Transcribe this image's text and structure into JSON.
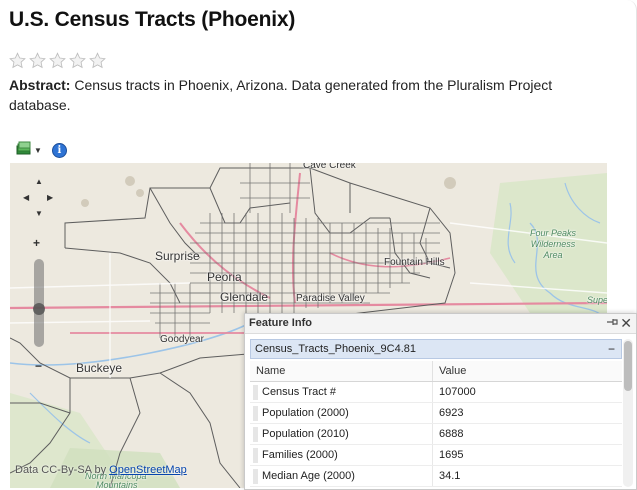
{
  "page": {
    "title": "U.S. Census Tracts (Phoenix)",
    "rating": {
      "max": 5,
      "value": 0
    },
    "abstract_label": "Abstract:",
    "abstract_text": "Census tracts in Phoenix, Arizona. Data generated from the Pluralism Project database."
  },
  "toolbar": {
    "layers_icon": "layers-icon",
    "dropdown_icon": "chevron-down-icon",
    "info_icon": "info-icon",
    "info_glyph": "i"
  },
  "map": {
    "labels": {
      "cave_creek": "Cave Creek",
      "surprise": "Surprise",
      "peoria": "Peoria",
      "glendale": "Glendale",
      "paradise_valley": "Paradise Valley",
      "fountain_hills": "Fountain Hills",
      "goodyear": "Goodyear",
      "buckeye": "Buckeye",
      "four_peaks_1": "Four Peaks",
      "four_peaks_2": "Wilderness",
      "four_peaks_3": "Area",
      "supe": "Supe",
      "north_maricopa": "North Maricopa",
      "mountains": "Mountains"
    },
    "attribution_prefix": "Data CC-By-SA by ",
    "attribution_link": "OpenStreetMap",
    "controls": {
      "zoom_in": "+",
      "zoom_out": "−"
    },
    "colors": {
      "land": "#ede9df",
      "tract_line": "#5e5e5e",
      "highway": "#e58aa0",
      "arterial": "#ffffff",
      "water": "#b9d4ee",
      "park": "#c8dfb5"
    }
  },
  "feature_info": {
    "title": "Feature Info",
    "group_label": "Census_Tracts_Phoenix_9C4.81",
    "collapse_glyph": "−",
    "close_glyph": "✕",
    "pin_glyph": "⊣",
    "columns": {
      "name": "Name",
      "value": "Value"
    },
    "rows": [
      {
        "name": "Census Tract #",
        "value": "107000"
      },
      {
        "name": "Population (2000)",
        "value": "6923"
      },
      {
        "name": "Population (2010)",
        "value": "6888"
      },
      {
        "name": "Families (2000)",
        "value": "1695"
      },
      {
        "name": "Median Age (2000)",
        "value": "34.1"
      }
    ]
  }
}
